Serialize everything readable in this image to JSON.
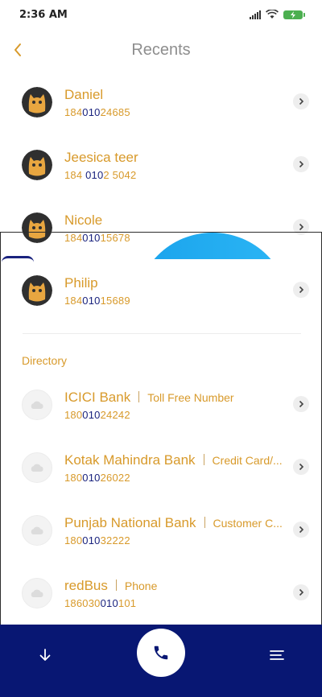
{
  "status_bar": {
    "time": "2:36 AM"
  },
  "header": {
    "title": "Recents"
  },
  "recents": [
    {
      "name": "Daniel",
      "number_parts": [
        "184",
        "010",
        "24685"
      ]
    },
    {
      "name": "Jeesica teer",
      "number_parts": [
        "184 ",
        "010",
        "2 5042"
      ]
    },
    {
      "name": "Nicole",
      "number_parts": [
        "184",
        "010",
        "15678"
      ]
    },
    {
      "name": "Philip",
      "number_parts": [
        "184",
        "010",
        "15689"
      ]
    }
  ],
  "directory": {
    "label": "Directory",
    "items": [
      {
        "name": "ICICI Bank",
        "tag": "Toll Free Number",
        "number_parts": [
          "180",
          "010",
          "24242"
        ]
      },
      {
        "name": "Kotak Mahindra Bank",
        "tag": "Credit Card/...",
        "number_parts": [
          "180",
          "010",
          "26022"
        ]
      },
      {
        "name": "Punjab National Bank",
        "tag": "Customer C...",
        "number_parts": [
          "180",
          "010",
          "32222"
        ]
      },
      {
        "name": "redBus",
        "tag": "Phone",
        "number_parts": [
          "186030",
          "010",
          "101"
        ]
      }
    ]
  },
  "colors": {
    "accent": "#d89a2b",
    "highlight": "#1a237e",
    "bottom_bar": "#081773",
    "title": "#8e8e8e"
  },
  "icons": {
    "back": "chevron-left-icon",
    "chevron": "chevron-right-icon",
    "down": "arrow-down-icon",
    "call": "phone-icon",
    "menu": "menu-icon"
  }
}
